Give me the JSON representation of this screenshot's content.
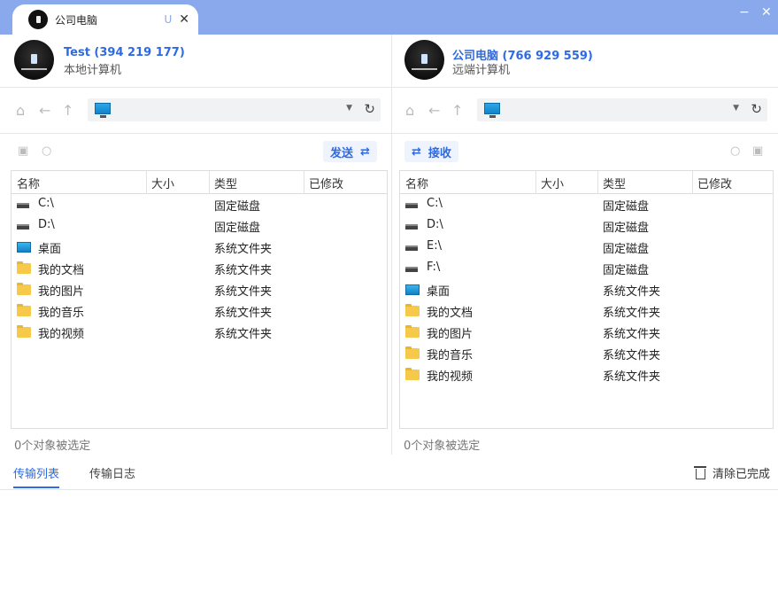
{
  "tab": {
    "title": "公司电脑",
    "badge": "U",
    "close": "✕"
  },
  "window": {
    "minimize": "−",
    "close": "✕"
  },
  "local": {
    "name": "Test (394 219 177)",
    "sub": "本地计算机",
    "action_label": "发送",
    "columns": [
      "名称",
      "大小",
      "类型",
      "已修改"
    ],
    "rows": [
      {
        "icon": "drive-icon",
        "name": "C:\\",
        "type": "固定磁盘"
      },
      {
        "icon": "drive-icon",
        "name": "D:\\",
        "type": "固定磁盘"
      },
      {
        "icon": "desktop-icon",
        "name": "桌面",
        "type": "系统文件夹"
      },
      {
        "icon": "folder-icon",
        "name": "我的文档",
        "type": "系统文件夹"
      },
      {
        "icon": "folder-icon",
        "name": "我的图片",
        "type": "系统文件夹"
      },
      {
        "icon": "folder-icon",
        "name": "我的音乐",
        "type": "系统文件夹"
      },
      {
        "icon": "folder-icon",
        "name": "我的视频",
        "type": "系统文件夹"
      }
    ],
    "status": "0个对象被选定"
  },
  "remote": {
    "name": "公司电脑 (766 929 559)",
    "sub": "远端计算机",
    "action_label": "接收",
    "columns": [
      "名称",
      "大小",
      "类型",
      "已修改"
    ],
    "rows": [
      {
        "icon": "drive-icon",
        "name": "C:\\",
        "type": "固定磁盘"
      },
      {
        "icon": "drive-icon",
        "name": "D:\\",
        "type": "固定磁盘"
      },
      {
        "icon": "drive-icon",
        "name": "E:\\",
        "type": "固定磁盘"
      },
      {
        "icon": "drive-icon",
        "name": "F:\\",
        "type": "固定磁盘"
      },
      {
        "icon": "desktop-icon",
        "name": "桌面",
        "type": "系统文件夹"
      },
      {
        "icon": "folder-icon",
        "name": "我的文档",
        "type": "系统文件夹"
      },
      {
        "icon": "folder-icon",
        "name": "我的图片",
        "type": "系统文件夹"
      },
      {
        "icon": "folder-icon",
        "name": "我的音乐",
        "type": "系统文件夹"
      },
      {
        "icon": "folder-icon",
        "name": "我的视频",
        "type": "系统文件夹"
      }
    ],
    "status": "0个对象被选定"
  },
  "bottom": {
    "tabs": [
      "传输列表",
      "传输日志"
    ],
    "clear_label": "清除已完成"
  },
  "colors": {
    "accent": "#2d6ae3",
    "titlebar": "#8aa8ec"
  }
}
